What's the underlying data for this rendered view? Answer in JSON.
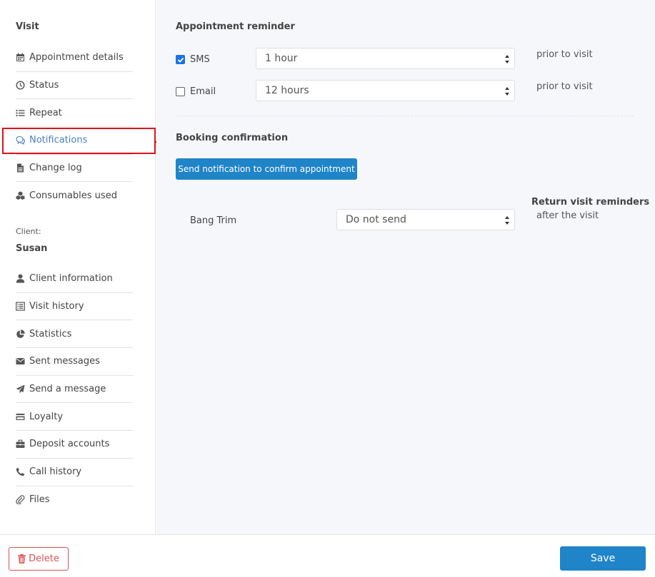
{
  "sidebar": {
    "visit_heading": "Visit",
    "visit_items": [
      {
        "label": "Appointment details",
        "icon": "calendar-icon"
      },
      {
        "label": "Status",
        "icon": "clock-icon"
      },
      {
        "label": "Repeat",
        "icon": "list-icon"
      },
      {
        "label": "Notifications",
        "icon": "chat-icon",
        "active": true
      },
      {
        "label": "Change log",
        "icon": "file-icon"
      },
      {
        "label": "Consumables used",
        "icon": "cubes-icon"
      }
    ],
    "client_caption": "Client:",
    "client_name": "Susan",
    "client_items": [
      {
        "label": "Client information",
        "icon": "user-icon"
      },
      {
        "label": "Visit history",
        "icon": "list-alt-icon"
      },
      {
        "label": "Statistics",
        "icon": "pie-chart-icon"
      },
      {
        "label": "Sent messages",
        "icon": "envelope-icon"
      },
      {
        "label": "Send a message",
        "icon": "paper-plane-icon"
      },
      {
        "label": "Loyalty",
        "icon": "credit-card-icon"
      },
      {
        "label": "Deposit accounts",
        "icon": "briefcase-icon"
      },
      {
        "label": "Call history",
        "icon": "phone-icon"
      },
      {
        "label": "Files",
        "icon": "paperclip-icon"
      }
    ]
  },
  "main": {
    "appointment_reminder": {
      "title": "Appointment reminder",
      "sms": {
        "label": "SMS",
        "checked": true,
        "value": "1 hour",
        "suffix": "prior to visit"
      },
      "email": {
        "label": "Email",
        "checked": false,
        "value": "12 hours",
        "suffix": "prior to visit"
      }
    },
    "booking_confirmation": {
      "title": "Booking confirmation",
      "button_label": "Send notification to confirm appointment"
    },
    "return_visit": {
      "title": "Return visit reminders",
      "subtitle": "after the visit",
      "service": "Bang Trim",
      "value": "Do not send"
    }
  },
  "footer": {
    "delete_label": "Delete",
    "save_label": "Save"
  },
  "colors": {
    "primary": "#1f84c8",
    "danger": "#d9534f",
    "active_link": "#4a7fbf",
    "highlight": "#e0121a"
  }
}
